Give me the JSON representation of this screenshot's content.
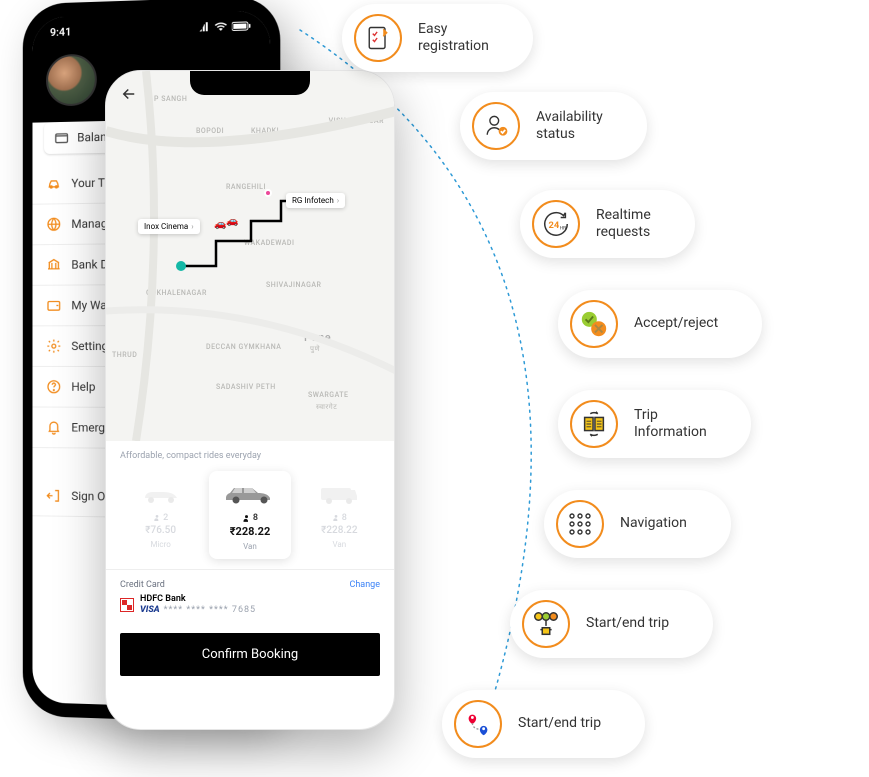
{
  "status_bar": {
    "time": "9:41"
  },
  "balance_chip": {
    "label": "Balance"
  },
  "menu": {
    "items": [
      {
        "label": "Your Trips",
        "icon": "trips"
      },
      {
        "label": "Manage Vehicles",
        "icon": "manage"
      },
      {
        "label": "Bank Details",
        "icon": "bank"
      },
      {
        "label": "My Wallet",
        "icon": "wallet"
      },
      {
        "label": "Settings",
        "icon": "settings"
      },
      {
        "label": "Help",
        "icon": "help"
      },
      {
        "label": "Emergency",
        "icon": "emergency"
      }
    ],
    "signout": {
      "label": "Sign Out"
    }
  },
  "map": {
    "marker_a": "Inox Cinema",
    "marker_b": "RG Infotech",
    "places": {
      "sangh": "P SANGH",
      "bopodi": "BOPODI",
      "khadki": "KHADKI",
      "vishal": "VISHAL NAGAR",
      "thrud": "THRUD",
      "rangehil": "RANGEHILI",
      "wakadewadi": "WAKADEWADI",
      "gokhale": "GOKHALENAGAR",
      "shivaji": "SHIVAJINAGAR",
      "deccan": "DECCAN GYMKHANA",
      "pune": "Pune",
      "pune_hi": "पुणे",
      "sadashiv": "SADASHIV PETH",
      "swargate": "SWARGATE",
      "swargate_hi": "स्वारगेट"
    }
  },
  "ride": {
    "tagline": "Affordable, compact rides everyday",
    "vehicles": [
      {
        "name": "Micro",
        "capacity": "2",
        "price": "₹76.50"
      },
      {
        "name": "Van",
        "capacity": "8",
        "price": "₹228.22"
      },
      {
        "name": "Van",
        "capacity": "8",
        "price": "₹228.22"
      }
    ]
  },
  "payment": {
    "label": "Credit Card",
    "change": "Change",
    "bank": "HDFC Bank",
    "brand": "VISA",
    "masked": "**** **** **** 7685"
  },
  "confirm_button": "Confirm Booking",
  "features": [
    {
      "label": "Easy registration"
    },
    {
      "label": "Availability status"
    },
    {
      "label": "Realtime requests"
    },
    {
      "label": "Accept/reject"
    },
    {
      "label": "Trip Information"
    },
    {
      "label": "Navigation"
    },
    {
      "label": "Start/end trip"
    },
    {
      "label": "Start/end trip"
    }
  ]
}
